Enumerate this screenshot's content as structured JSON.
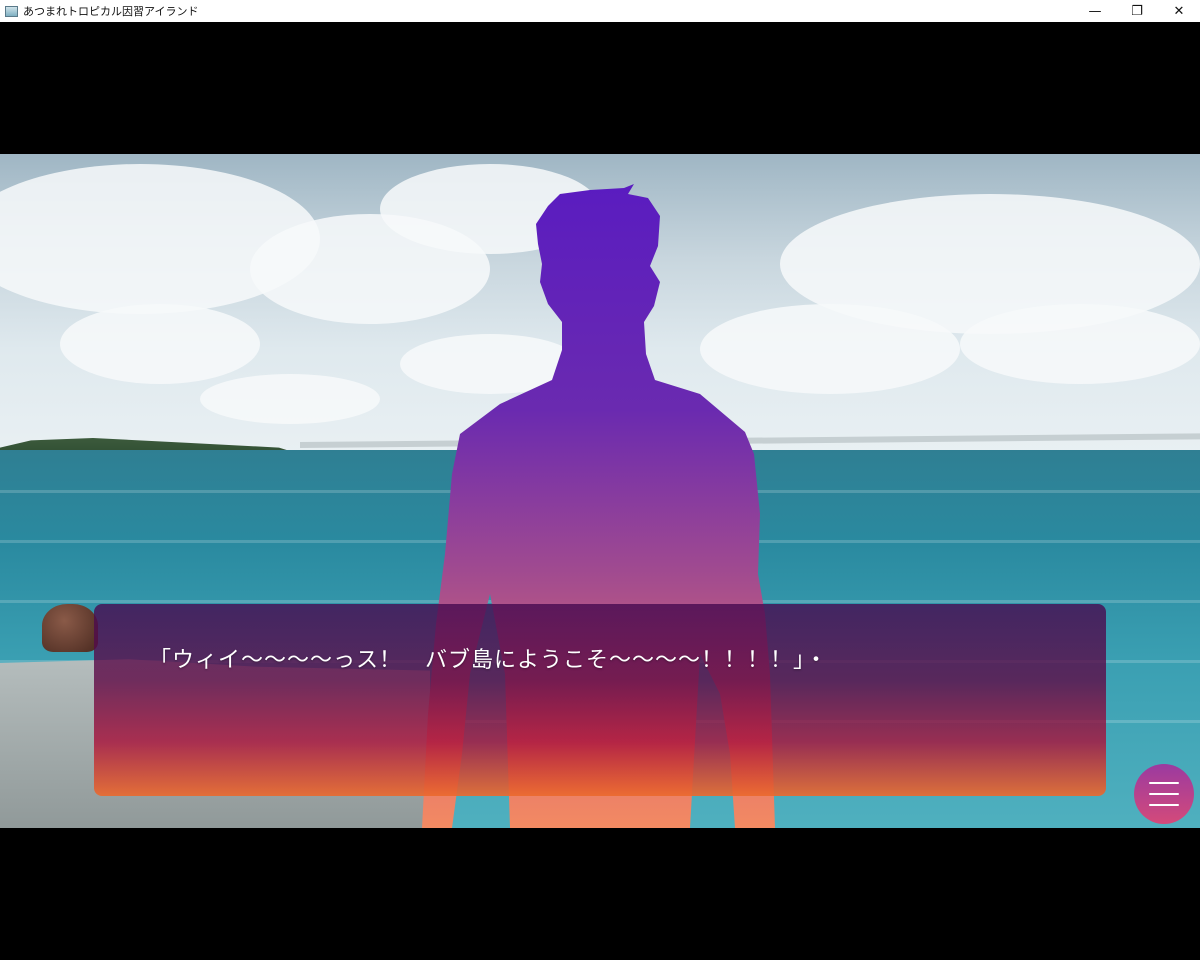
{
  "window": {
    "title": "あつまれトロピカル因習アイランド",
    "controls": {
      "minimize": "—",
      "maximize": "❐",
      "close": "✕"
    }
  },
  "scene": {
    "background": "tropical-sea-pier",
    "character": "purple-gradient-silhouette-man"
  },
  "dialogue": {
    "text": "「ウィイ〜〜〜〜っス！　バブ島にようこそ〜〜〜〜！！！！」・"
  },
  "menu": {
    "icon": "hamburger-menu-icon"
  },
  "colors": {
    "silhouette_top": "#5a1cc0",
    "silhouette_bottom": "#f38a62",
    "dialogue_top": "#4a0a58",
    "dialogue_bottom": "#ec6a2e",
    "menu_button": "#b54090"
  }
}
